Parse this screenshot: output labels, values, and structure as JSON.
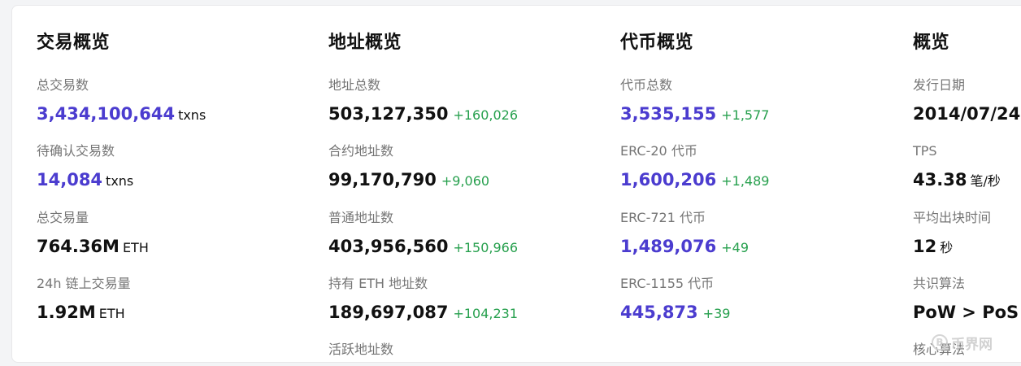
{
  "transactions": {
    "title": "交易概览",
    "total_txns": {
      "label": "总交易数",
      "value": "3,434,100,644",
      "unit": "txns"
    },
    "pending_txns": {
      "label": "待确认交易数",
      "value": "14,084",
      "unit": "txns"
    },
    "total_volume": {
      "label": "总交易量",
      "value": "764.36M",
      "unit": "ETH"
    },
    "volume_24h": {
      "label": "24h 链上交易量",
      "value": "1.92M",
      "unit": "ETH"
    }
  },
  "addresses": {
    "title": "地址概览",
    "total": {
      "label": "地址总数",
      "value": "503,127,350",
      "delta": "+160,026"
    },
    "contract": {
      "label": "合约地址数",
      "value": "99,170,790",
      "delta": "+9,060"
    },
    "regular": {
      "label": "普通地址数",
      "value": "403,956,560",
      "delta": "+150,966"
    },
    "eth_holders": {
      "label": "持有 ETH 地址数",
      "value": "189,697,087",
      "delta": "+104,231"
    },
    "active": {
      "label": "活跃地址数"
    }
  },
  "tokens": {
    "title": "代币概览",
    "total": {
      "label": "代币总数",
      "value": "3,535,155",
      "delta": "+1,577"
    },
    "erc20": {
      "label": "ERC-20 代币",
      "value": "1,600,206",
      "delta": "+1,489"
    },
    "erc721": {
      "label": "ERC-721 代币",
      "value": "1,489,076",
      "delta": "+49"
    },
    "erc1155": {
      "label": "ERC-1155 代币",
      "value": "445,873",
      "delta": "+39"
    }
  },
  "overview": {
    "title": "概览",
    "launch_date": {
      "label": "发行日期",
      "value": "2014/07/24"
    },
    "tps": {
      "label": "TPS",
      "value": "43.38",
      "unit": "笔/秒"
    },
    "block_time": {
      "label": "平均出块时间",
      "value": "12",
      "unit": "秒"
    },
    "consensus": {
      "label": "共识算法",
      "value": "PoW > PoS"
    },
    "core_algo": {
      "label": "核心算法"
    }
  },
  "watermark": {
    "icon": "B",
    "text": "币界网"
  },
  "colors": {
    "link": "#4b3ccf",
    "positive": "#27a04e",
    "label": "#757575"
  }
}
